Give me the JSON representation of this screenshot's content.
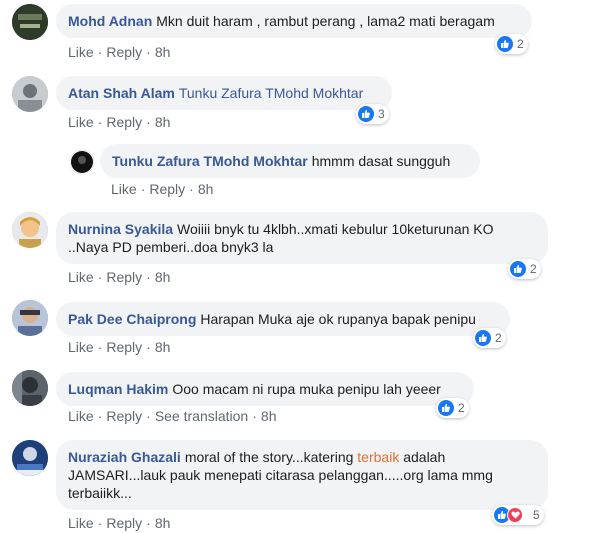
{
  "actions": {
    "like": "Like",
    "reply": "Reply",
    "dot": "·",
    "see_translation": "See translation"
  },
  "comments": [
    {
      "author": "Mohd Adnan",
      "text": "Mkn duit haram , rambut perang , lama2 mati beragam",
      "time": "8h",
      "reactions": "2",
      "avatar_color": "#2f3b2a",
      "reaction_icons": [
        "like-icon"
      ]
    },
    {
      "author": "Atan Shah Alam",
      "text": "Tunku Zafura TMohd Mokhtar",
      "time": "8h",
      "reactions": "3",
      "avatar_color": "#9aa0a6",
      "reaction_icons": [
        "like-icon"
      ]
    },
    {
      "author": "Tunku Zafura TMohd Mokhtar",
      "text": "hmmm dasat sungguh",
      "time": "8h",
      "reactions": "",
      "avatar_color": "#222222",
      "reaction_icons": []
    },
    {
      "author": "Nurnina Syakila",
      "text_line1": "Woiiii bnyk tu 4klbh..xmati kebulur 10keturunan KO",
      "text_line2": "..Naya PD pemberi..doa bnyk3 la",
      "time": "8h",
      "reactions": "2",
      "avatar_color": "#d4a13a",
      "reaction_icons": [
        "like-icon"
      ]
    },
    {
      "author": "Pak Dee Chaiprong",
      "text": "Harapan Muka aje ok rupanya bapak penipu",
      "time": "8h",
      "reactions": "2",
      "avatar_color": "#7b8fb5",
      "reaction_icons": [
        "like-icon"
      ]
    },
    {
      "author": "Luqman Hakim",
      "text": "Ooo macam ni rupa muka penipu lah yeeer",
      "time": "8h",
      "reactions": "2",
      "avatar_color": "#4a4f55",
      "reaction_icons": [
        "like-icon"
      ]
    },
    {
      "author": "Nuraziah Ghazali",
      "text_pre": "moral of the story...katering ",
      "text_hl": "terbaik",
      "text_post": " adalah",
      "text_line2": "JAMSARI...lauk pauk menepati citarasa pelanggan.....org lama mmg",
      "text_line3": "terbaiikk...",
      "time": "8h",
      "reactions": "5",
      "avatar_color": "#2d5aa8",
      "reaction_icons": [
        "like-icon",
        "love-icon"
      ]
    }
  ],
  "colors": {
    "author": "#385898",
    "bubble": "#f2f3f5",
    "like": "#1877f2",
    "love": "#f33e58",
    "highlight": "#e4702c"
  }
}
